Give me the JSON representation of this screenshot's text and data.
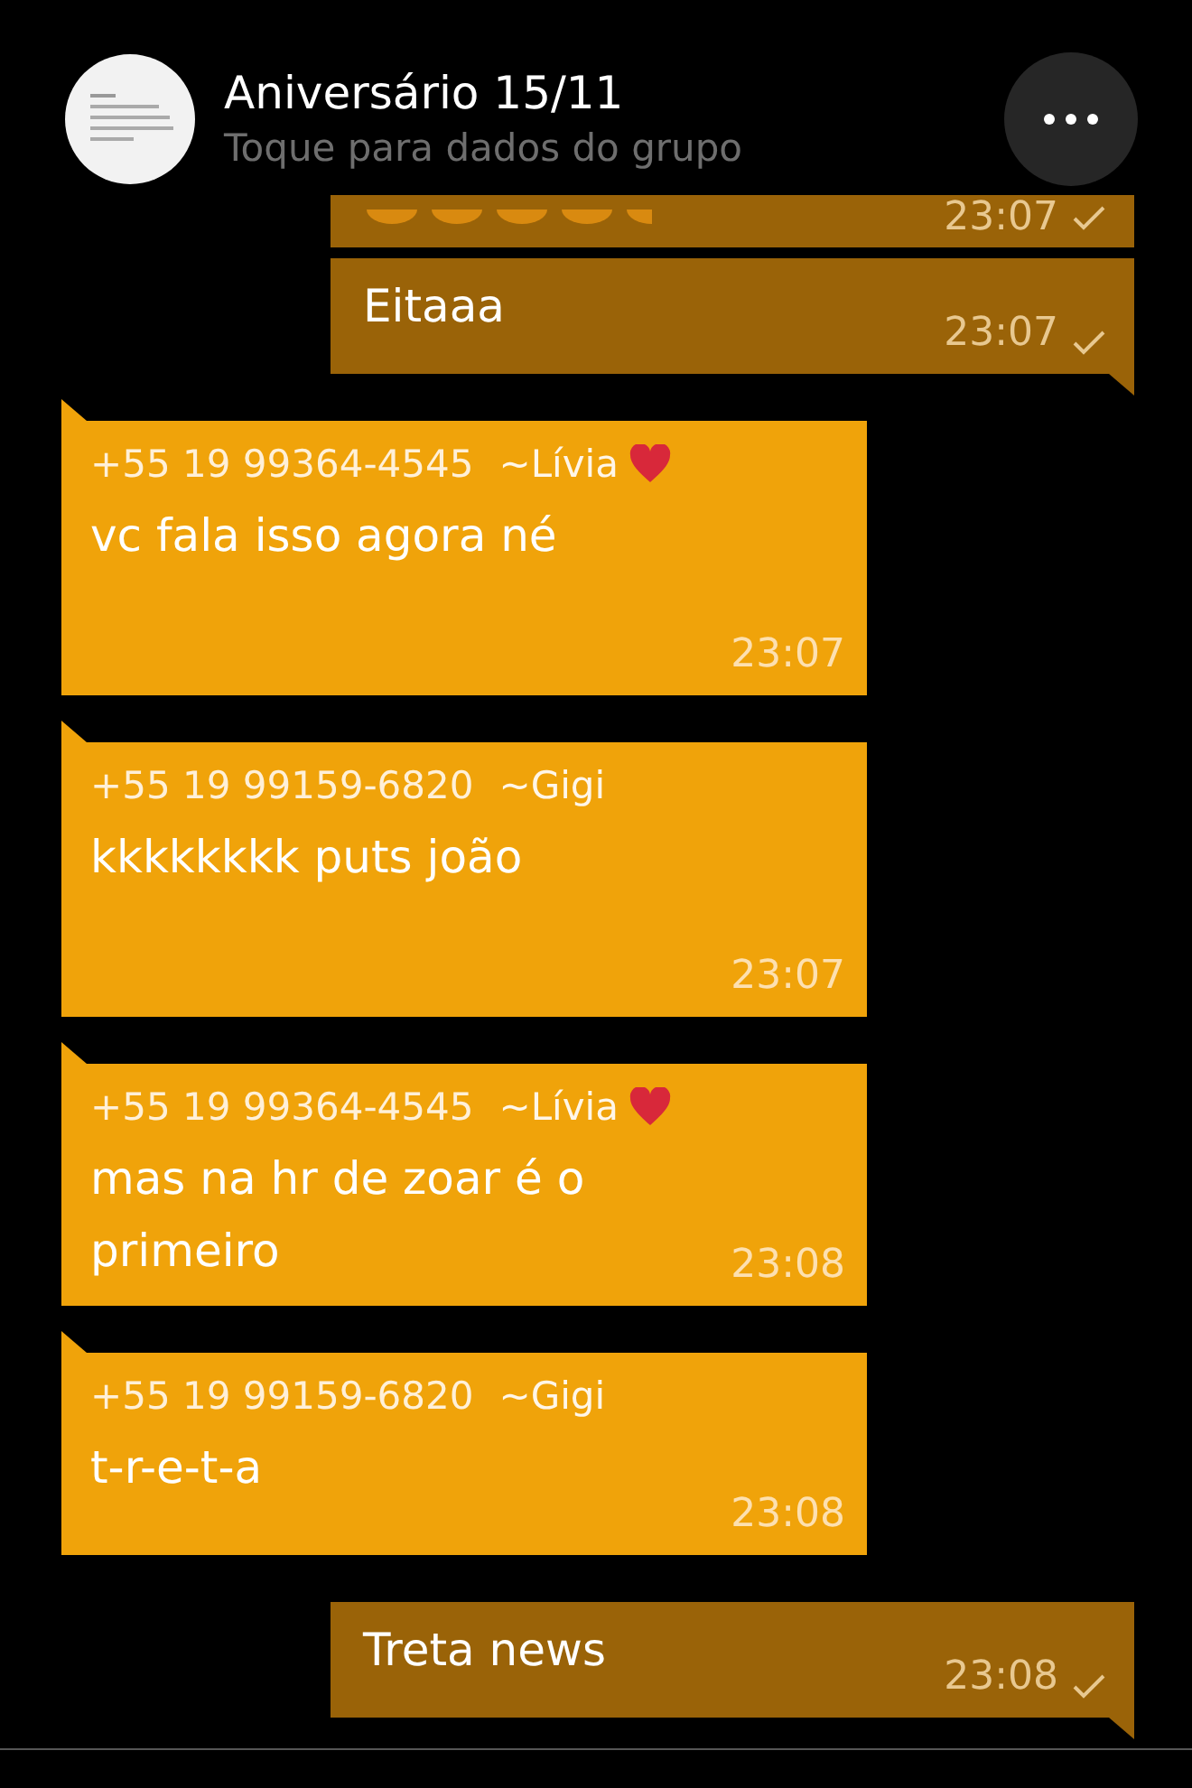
{
  "header": {
    "title": "Aniversário 15/11",
    "subtitle": "Toque para dados do grupo"
  },
  "messages": [
    {
      "kind": "outgoing_partial",
      "time": "23:07",
      "tick": true
    },
    {
      "kind": "outgoing",
      "text": "Eitaaa",
      "time": "23:07",
      "tick": true
    },
    {
      "kind": "incoming",
      "sender": {
        "phone": "+55 19 99364-4545",
        "name": "~Lívia",
        "heart": true
      },
      "text": "vc fala isso agora né",
      "time": "23:07"
    },
    {
      "kind": "incoming",
      "sender": {
        "phone": "+55 19 99159-6820",
        "name": "~Gigi",
        "heart": false
      },
      "text": "kkkkkkkk puts joão",
      "time": "23:07"
    },
    {
      "kind": "incoming",
      "sender": {
        "phone": "+55 19 99364-4545",
        "name": "~Lívia",
        "heart": true
      },
      "text": "mas na hr de zoar é o primeiro",
      "time": "23:08"
    },
    {
      "kind": "incoming",
      "sender": {
        "phone": "+55 19 99159-6820",
        "name": "~Gigi",
        "heart": false
      },
      "text": "t-r-e-t-a",
      "time": "23:08"
    },
    {
      "kind": "outgoing",
      "text": "Treta news",
      "time": "23:08",
      "tick": true
    }
  ]
}
